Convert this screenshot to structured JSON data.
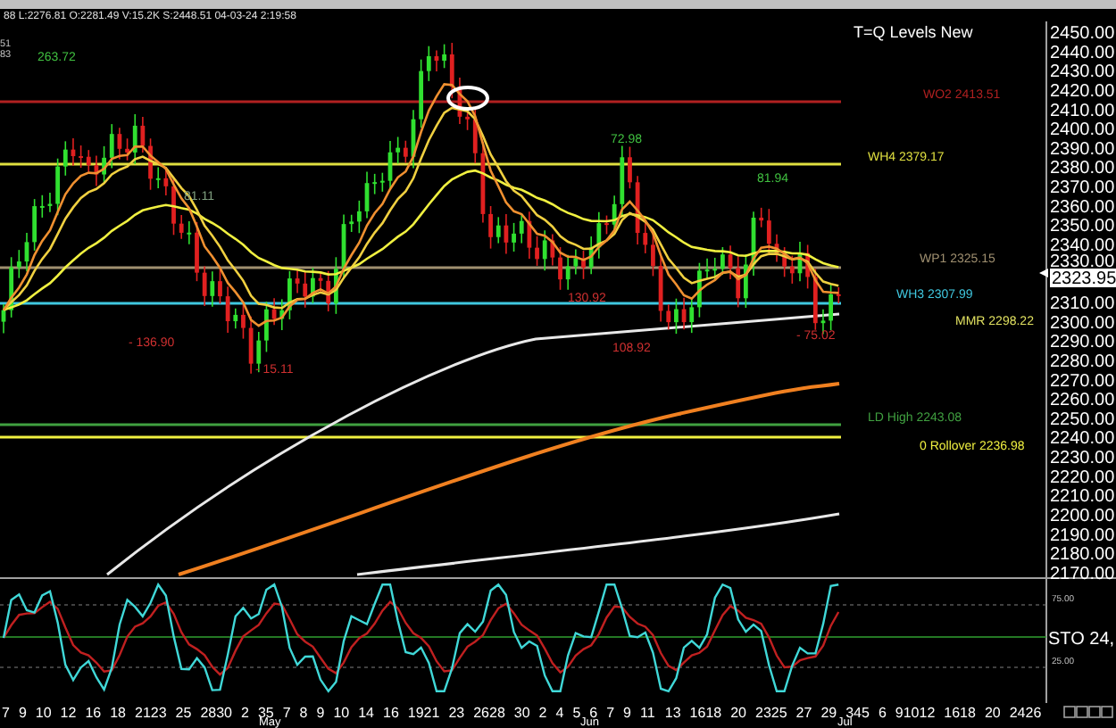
{
  "header": {
    "quote_line": "88 L:2276.81 O:2281.49 V:15.2K S:2448.51 04-03-24 2:19:58"
  },
  "chart": {
    "title": "T=Q Levels New",
    "corner_values": [
      "51",
      "83"
    ],
    "price_axis": [
      "2450.00",
      "2440.00",
      "2430.00",
      "2420.00",
      "2410.00",
      "2400.00",
      "2390.00",
      "2380.00",
      "2370.00",
      "2360.00",
      "2350.00",
      "2340.00",
      "2330.00",
      "2310.00",
      "2300.00",
      "2290.00",
      "2280.00",
      "2270.00",
      "2260.00",
      "2250.00",
      "2240.00",
      "2230.00",
      "2220.00",
      "2210.00",
      "2200.00",
      "2190.00",
      "2180.00",
      "2170.00"
    ],
    "last_price": "2323.95",
    "annotations": [
      {
        "text": "263.72",
        "color": "#40c040"
      },
      {
        "text": "81.11",
        "color": "#80a080"
      },
      {
        "text": "- 136.90",
        "color": "#d03030"
      },
      {
        "text": "- 15.11",
        "color": "#d03030"
      },
      {
        "text": "130.92",
        "color": "#d03030"
      },
      {
        "text": "72.98",
        "color": "#40c040"
      },
      {
        "text": "108.92",
        "color": "#d03030"
      },
      {
        "text": "81.94",
        "color": "#40c040"
      },
      {
        "text": "- 75.02",
        "color": "#d03030"
      }
    ],
    "levels": [
      {
        "label": "WO2 2413.51",
        "color": "#b02020"
      },
      {
        "label": "WH4 2379.17",
        "color": "#e0e040"
      },
      {
        "label": "WP1 2325.15",
        "color": "#a09070"
      },
      {
        "label": "WH3 2307.99",
        "color": "#40c8e0"
      },
      {
        "label": "MMR 2298.22",
        "color": "#e0e060"
      },
      {
        "label": "LD High 2243.08",
        "color": "#40a040"
      },
      {
        "label": "0 Rollover 2236.98",
        "color": "#f0f040"
      }
    ]
  },
  "oscillator": {
    "label": "STO 24,",
    "ticks": [
      "75.00",
      "25.00"
    ]
  },
  "date_axis": {
    "dates": [
      "7",
      "9",
      "10",
      "12",
      "16",
      "18",
      "2123",
      "25",
      "2830",
      "2",
      "35",
      "7",
      "8",
      "9",
      "10",
      "14",
      "16",
      "1921",
      "23",
      "2628",
      "30",
      "2",
      "4",
      "5",
      "6",
      "7",
      "9",
      "11",
      "13",
      "1618",
      "20",
      "2325",
      "27",
      "29",
      "345",
      "6",
      "91012",
      "1618",
      "20",
      "2426"
    ],
    "months": [
      "May",
      "Jun",
      "Jul"
    ]
  }
}
